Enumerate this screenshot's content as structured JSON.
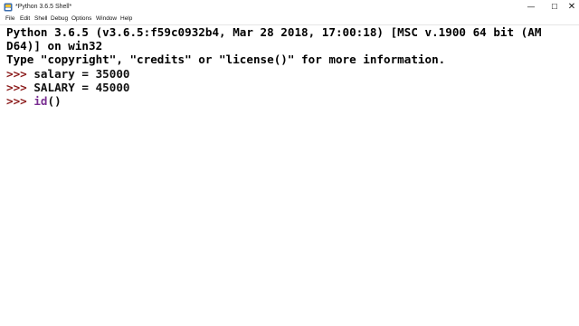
{
  "window": {
    "title": "*Python 3.6.5 Shell*",
    "controls": {
      "minimize_glyph": "—",
      "maximize_glyph": "☐",
      "close_glyph": "✕"
    }
  },
  "menubar": {
    "items": [
      "File",
      "Edit",
      "Shell",
      "Debug",
      "Options",
      "Window",
      "Help"
    ]
  },
  "shell": {
    "banner_line_1": "Python 3.6.5 (v3.6.5:f59c0932b4, Mar 28 2018, 17:00:18) [MSC v.1900 64 bit (AM",
    "banner_line_2": "D64)] on win32",
    "banner_line_3": "Type \"copyright\", \"credits\" or \"license()\" for more information.",
    "prompt": ">>> ",
    "commands": [
      "salary = 35000",
      "SALARY = 45000"
    ],
    "current_input": {
      "builtin": "id",
      "rest": "()"
    }
  },
  "colors": {
    "prompt": "#8b1a1a",
    "builtin": "#7a2f92",
    "text": "#000000",
    "background": "#ffffff"
  },
  "icons": {
    "app": "python-idle-icon"
  }
}
